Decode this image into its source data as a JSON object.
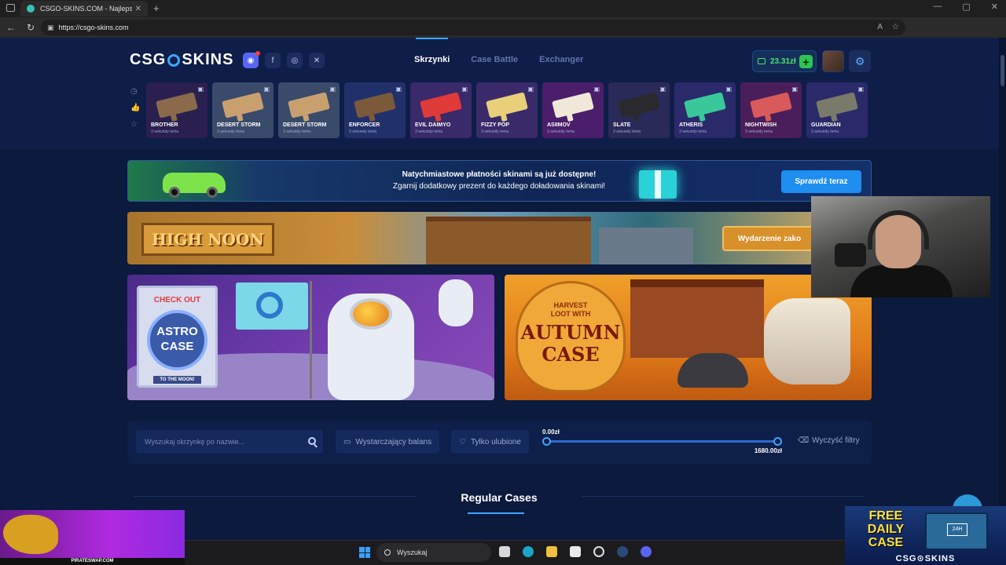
{
  "browser": {
    "tab_title": "CSGO-SKINS.COM - Najlepsze Sk",
    "tab_close": "✕",
    "new_tab": "+",
    "url": "https://csgo-skins.com",
    "window_minimize": "—",
    "window_maximize": "▢",
    "window_close": "✕"
  },
  "site": {
    "logo_left": "CSG",
    "logo_right": "SKINS",
    "nav": {
      "tab1": "Skrzynki",
      "tab2": "Case Battle",
      "tab3": "Exchanger"
    },
    "balance": "23.31zł",
    "add_label": "+",
    "social": {
      "facebook": "f",
      "instagram": "◎",
      "x": "✕"
    }
  },
  "live_drops": [
    {
      "name": "BROTHER",
      "time": "3 sekundy temu",
      "bg": "#2b1f4f",
      "gun": "#8a6a4a"
    },
    {
      "name": "DESERT STORM",
      "time": "3 sekundy temu",
      "bg": "#3a4a6a",
      "gun": "#c8a070"
    },
    {
      "name": "DESERT STORM",
      "time": "3 sekundy temu",
      "bg": "#3a4a6a",
      "gun": "#c8a070"
    },
    {
      "name": "ENFORCER",
      "time": "3 sekundy temu",
      "bg": "#22306a",
      "gun": "#7a5a3a"
    },
    {
      "name": "EVIL DAIMYO",
      "time": "3 sekundy temu",
      "bg": "#3a2a6a",
      "gun": "#e03a3a"
    },
    {
      "name": "FIZZY POP",
      "time": "3 sekundy temu",
      "bg": "#3a2a6a",
      "gun": "#e8d07a"
    },
    {
      "name": "ASIIMOV",
      "time": "3 sekundy temu",
      "bg": "#4a1e6a",
      "gun": "#f0e8d8"
    },
    {
      "name": "SLATE",
      "time": "3 sekundy temu",
      "bg": "#2a2a5a",
      "gun": "#2a2a2e"
    },
    {
      "name": "ATHERIS",
      "time": "3 sekundy temu",
      "bg": "#2a2a6a",
      "gun": "#3ac89a"
    },
    {
      "name": "NIGHTWISH",
      "time": "3 sekundy temu",
      "bg": "#4a1e5a",
      "gun": "#d85a5a"
    },
    {
      "name": "GUARDIAN",
      "time": "3 sekundy temu",
      "bg": "#2a2a6a",
      "gun": "#7a7a6a"
    }
  ],
  "banners": {
    "payments_line1": "Natychmiastowe płatności skinami są już dostępne!",
    "payments_line2": "Zgarnij dodatkowy prezent do każdego doładowania skinami!",
    "payments_button": "Sprawdź teraz",
    "event_title": "HIGH NOON",
    "event_button": "Wydarzenie zako"
  },
  "promos": {
    "astro_check": "CHECK OUT",
    "astro_name": "ASTRO CASE",
    "astro_tag": "TO THE MOON!",
    "autumn_line1": "HARVEST",
    "autumn_line2": "LOOT WITH",
    "autumn_name": "AUTUMN CASE"
  },
  "filters": {
    "search_placeholder": "Wyszukaj skrzynkę po nazwie...",
    "enough_balance": "Wystarczający balans",
    "favorites_only": "Tylko ulubione",
    "price_min": "0.00zł",
    "price_max": "1680.00zł",
    "clear": "Wyczyść filtry"
  },
  "section_title": "Regular Cases",
  "overlays": {
    "pirateswap": "PIRATESWAP.COM",
    "free_daily_case": "FREE DAILY CASE",
    "box_label": "24H",
    "brand": "CSG⊙SKINS"
  },
  "taskbar": {
    "search_label": "Wyszukaj"
  }
}
